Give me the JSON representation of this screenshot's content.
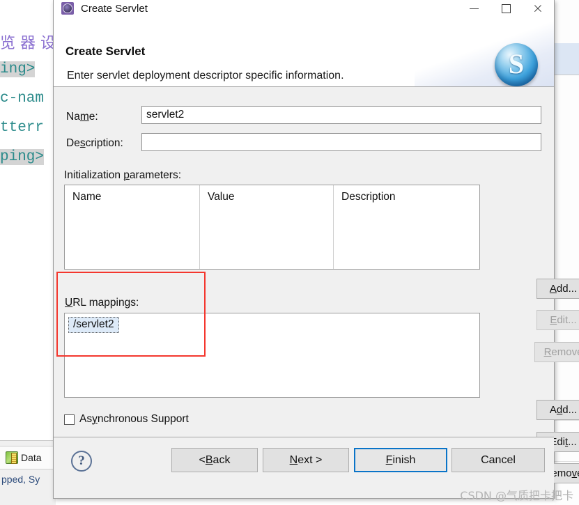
{
  "window": {
    "title": "Create Servlet",
    "icon": "servlet-wizard-icon",
    "minimize_label": "",
    "maximize_label": "",
    "close_label": "×"
  },
  "header": {
    "title": "Create Servlet",
    "description": "Enter servlet deployment descriptor specific information.",
    "logo_letter": "S",
    "logo_name": "spring-sphere-logo"
  },
  "form": {
    "name_label_pre": "Na",
    "name_label_mnemonic": "m",
    "name_label_post": "e:",
    "name_value": "servlet2",
    "name_placeholder": "",
    "description_label_pre": "De",
    "description_label_mnemonic": "s",
    "description_label_post": "cription:",
    "description_value": "",
    "description_placeholder": ""
  },
  "init_params": {
    "label_pre": "Initialization ",
    "label_mnemonic": "p",
    "label_post": "arameters:",
    "columns": [
      "Name",
      "Value",
      "Description"
    ],
    "rows": [],
    "buttons": [
      {
        "pre": "",
        "mnemonic": "A",
        "post": "dd...",
        "enabled": true
      },
      {
        "pre": "",
        "mnemonic": "E",
        "post": "dit...",
        "enabled": false
      },
      {
        "pre": "",
        "mnemonic": "R",
        "post": "emove",
        "enabled": false
      }
    ]
  },
  "url_mappings": {
    "label_pre": "",
    "label_mnemonic": "U",
    "label_post": "RL mappings:",
    "items": [
      "/servlet2"
    ],
    "selected": "/servlet2",
    "buttons": [
      {
        "pre": "A",
        "mnemonic": "d",
        "post": "d...",
        "enabled": true
      },
      {
        "pre": "Edi",
        "mnemonic": "t",
        "post": "...",
        "enabled": true
      },
      {
        "pre": "Remo",
        "mnemonic": "v",
        "post": "e",
        "enabled": true
      }
    ]
  },
  "async": {
    "label_pre": "As",
    "label_mnemonic": "y",
    "label_post": "nchronous Support",
    "checked": false
  },
  "footer": {
    "help_glyph": "?",
    "buttons": [
      {
        "pre": "< ",
        "mnemonic": "B",
        "post": "ack",
        "name": "back-button",
        "default": false
      },
      {
        "pre": "",
        "mnemonic": "N",
        "post": "ext >",
        "name": "next-button",
        "default": false
      },
      {
        "pre": "",
        "mnemonic": "F",
        "post": "inish",
        "name": "finish-button",
        "default": true
      },
      {
        "pre": "Cancel",
        "mnemonic": "",
        "post": "",
        "name": "cancel-button",
        "default": false
      }
    ]
  },
  "background": {
    "editor_lines": [
      {
        "text": "览 器 设",
        "kind": "cn"
      },
      {
        "text": "ing>",
        "kind": "tag-grey-blue"
      },
      {
        "text": "c-nam",
        "kind": "tag"
      },
      {
        "text": "tterr",
        "kind": "tag"
      },
      {
        "text": "ping>",
        "kind": "tag-grey"
      }
    ],
    "tab_label": "Data",
    "status_text": "pped, Sy"
  },
  "watermark": "CSDN @气质把卡把卡",
  "annotation": {
    "name": "red-highlight-rectangle",
    "color": "#f4372e"
  },
  "colors": {
    "accent": "#0a74c8",
    "dialog_bg": "#f0f0f0",
    "selection_bg": "#ddeaf8",
    "annotation": "#f4372e"
  }
}
